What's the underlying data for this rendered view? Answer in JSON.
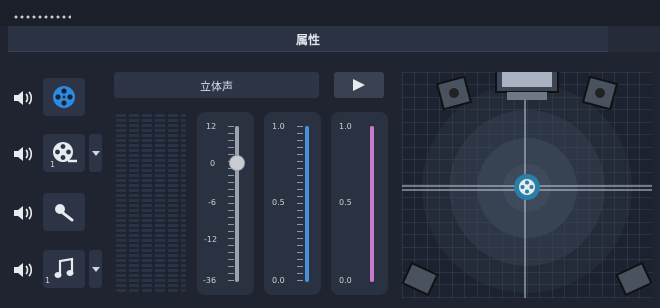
{
  "window": {
    "title": "属性"
  },
  "tracks": [
    {
      "icon": "video-reel-icon",
      "number": "",
      "dropdown": false,
      "active": true
    },
    {
      "icon": "film-reel-icon",
      "number": "1",
      "dropdown": true,
      "active": false
    },
    {
      "icon": "voice-mic-icon",
      "number": "",
      "dropdown": false,
      "active": false
    },
    {
      "icon": "music-note-icon",
      "number": "1",
      "dropdown": true,
      "active": false
    }
  ],
  "mode": {
    "label": "立体声"
  },
  "volume": {
    "ticks": [
      "12",
      "0",
      "-6",
      "-12",
      "-36"
    ],
    "value": "0"
  },
  "channel_a": {
    "ticks": [
      "1.0",
      "0.5",
      "0.0"
    ],
    "color": "#4a90d9"
  },
  "channel_b": {
    "ticks": [
      "1.0",
      "0.5",
      "0.0"
    ],
    "color": "#c77bd0"
  },
  "colors": {
    "accent": "#2a8be0",
    "panel": "#2a3140"
  }
}
